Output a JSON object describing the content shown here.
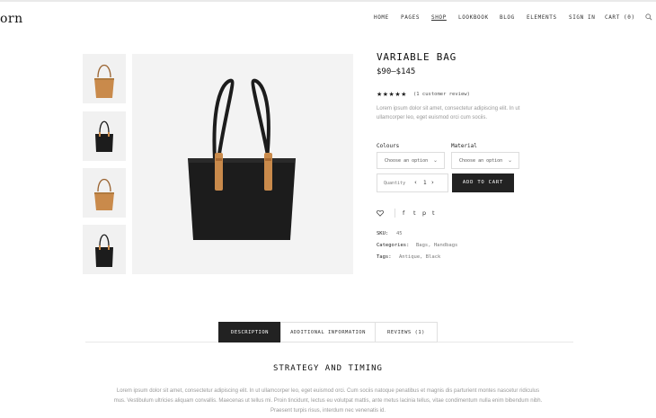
{
  "header": {
    "logo": "orn",
    "nav": [
      {
        "label": "HOME",
        "active": false
      },
      {
        "label": "PAGES",
        "active": false
      },
      {
        "label": "SHOP",
        "active": true
      },
      {
        "label": "LOOKBOOK",
        "active": false
      },
      {
        "label": "BLOG",
        "active": false
      },
      {
        "label": "ELEMENTS",
        "active": false
      },
      {
        "label": "SIGN IN",
        "active": false
      },
      {
        "label": "CART (0)",
        "active": false
      }
    ],
    "search_icon": "search-icon"
  },
  "gallery": {
    "thumbnails": [
      {
        "color": "tan",
        "icon": "bag-tan-image"
      },
      {
        "color": "black",
        "icon": "bag-black-image"
      },
      {
        "color": "tan",
        "icon": "bag-tan-image"
      },
      {
        "color": "black",
        "icon": "bag-black-image"
      }
    ],
    "main_color": "black"
  },
  "product": {
    "title": "VARIABLE BAG",
    "price": "$90–$145",
    "rating": 5,
    "stars": "★★★★★",
    "review_link": "(1 customer review)",
    "description": "Lorem ipsum dolor sit amet, consectetur adipiscing elit. In ut ullamcorper leo, eget euismod orci cum sociis.",
    "colours_label": "Colours",
    "colours_value": "Choose an option",
    "material_label": "Material",
    "material_value": "Choose an option",
    "quantity_label": "Quantity",
    "quantity_value": "1",
    "qty_minus": "‹",
    "qty_plus": "›",
    "add_to_cart": "ADD TO CART",
    "share_icons": [
      "f",
      "t",
      "p",
      "t"
    ],
    "sku_label": "SKU:",
    "sku_value": "45",
    "categories_label": "Categories:",
    "categories_value": "Bags, Handbags",
    "tags_label": "Tags:",
    "tags_value": "Antique, Black"
  },
  "tabs": [
    {
      "label": "DESCRIPTION",
      "active": true
    },
    {
      "label": "ADDITIONAL INFORMATION",
      "active": false
    },
    {
      "label": "REVIEWS (1)",
      "active": false
    }
  ],
  "content": {
    "heading": "STRATEGY AND TIMING",
    "text": "Lorem ipsum dolor sit amet, consectetur adipiscing elit. In ut ullamcorper leo, eget euismod orci. Cum sociis natoque penatibus et magnis dis parturient montes nascetur ridiculus mus. Vestibulum ultricies aliquam convallis. Maecenas ut tellus mi. Proin tincidunt, lectus eu volutpat mattis, ante metus lacinia tellus, vitae condimentum nulla enim bibendum nibh. Praesent turpis risus, interdum nec venenatis id."
  },
  "colors": {
    "accent": "#222222",
    "muted_text": "#999999",
    "bag_tan": "#c98a4b",
    "bag_black": "#1c1c1c"
  }
}
